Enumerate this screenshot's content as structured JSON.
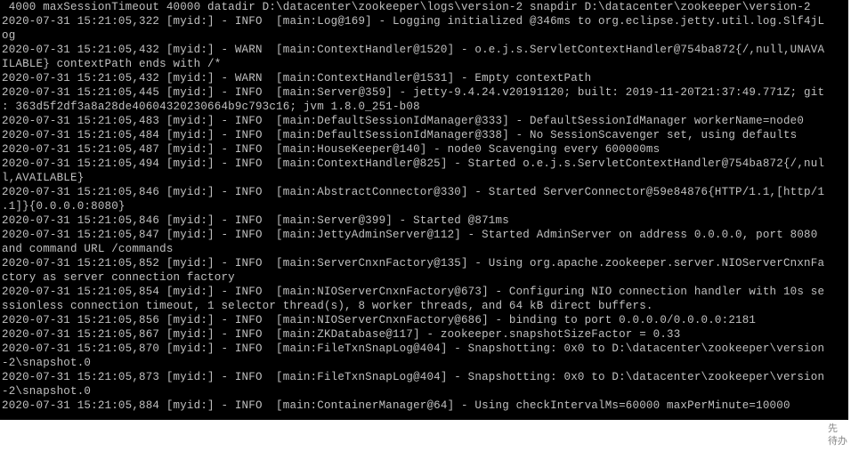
{
  "terminal": {
    "lines": [
      " 4000 maxSessionTimeout 40000 datadir D:\\datacenter\\zookeeper\\logs\\version-2 snapdir D:\\datacenter\\zookeeper\\version-2",
      "2020-07-31 15:21:05,322 [myid:] - INFO  [main:Log@169] - Logging initialized @346ms to org.eclipse.jetty.util.log.Slf4jL",
      "og",
      "2020-07-31 15:21:05,432 [myid:] - WARN  [main:ContextHandler@1520] - o.e.j.s.ServletContextHandler@754ba872{/,null,UNAVA",
      "ILABLE} contextPath ends with /*",
      "2020-07-31 15:21:05,432 [myid:] - WARN  [main:ContextHandler@1531] - Empty contextPath",
      "2020-07-31 15:21:05,445 [myid:] - INFO  [main:Server@359] - jetty-9.4.24.v20191120; built: 2019-11-20T21:37:49.771Z; git",
      ": 363d5f2df3a8a28de40604320230664b9c793c16; jvm 1.8.0_251-b08",
      "2020-07-31 15:21:05,483 [myid:] - INFO  [main:DefaultSessionIdManager@333] - DefaultSessionIdManager workerName=node0",
      "2020-07-31 15:21:05,484 [myid:] - INFO  [main:DefaultSessionIdManager@338] - No SessionScavenger set, using defaults",
      "2020-07-31 15:21:05,487 [myid:] - INFO  [main:HouseKeeper@140] - node0 Scavenging every 600000ms",
      "2020-07-31 15:21:05,494 [myid:] - INFO  [main:ContextHandler@825] - Started o.e.j.s.ServletContextHandler@754ba872{/,nul",
      "l,AVAILABLE}",
      "2020-07-31 15:21:05,846 [myid:] - INFO  [main:AbstractConnector@330] - Started ServerConnector@59e84876{HTTP/1.1,[http/1",
      ".1]}{0.0.0.0:8080}",
      "2020-07-31 15:21:05,846 [myid:] - INFO  [main:Server@399] - Started @871ms",
      "2020-07-31 15:21:05,847 [myid:] - INFO  [main:JettyAdminServer@112] - Started AdminServer on address 0.0.0.0, port 8080 ",
      "and command URL /commands",
      "2020-07-31 15:21:05,852 [myid:] - INFO  [main:ServerCnxnFactory@135] - Using org.apache.zookeeper.server.NIOServerCnxnFa",
      "ctory as server connection factory",
      "2020-07-31 15:21:05,854 [myid:] - INFO  [main:NIOServerCnxnFactory@673] - Configuring NIO connection handler with 10s se",
      "ssionless connection timeout, 1 selector thread(s), 8 worker threads, and 64 kB direct buffers.",
      "2020-07-31 15:21:05,856 [myid:] - INFO  [main:NIOServerCnxnFactory@686] - binding to port 0.0.0.0/0.0.0.0:2181",
      "2020-07-31 15:21:05,867 [myid:] - INFO  [main:ZKDatabase@117] - zookeeper.snapshotSizeFactor = 0.33",
      "2020-07-31 15:21:05,870 [myid:] - INFO  [main:FileTxnSnapLog@404] - Snapshotting: 0x0 to D:\\datacenter\\zookeeper\\version",
      "-2\\snapshot.0",
      "2020-07-31 15:21:05,873 [myid:] - INFO  [main:FileTxnSnapLog@404] - Snapshotting: 0x0 to D:\\datacenter\\zookeeper\\version",
      "-2\\snapshot.0",
      "2020-07-31 15:21:05,884 [myid:] - INFO  [main:ContainerManager@64] - Using checkIntervalMs=60000 maxPerMinute=10000"
    ]
  },
  "sidebar": {
    "hint1": "先",
    "hint2": "待办"
  }
}
